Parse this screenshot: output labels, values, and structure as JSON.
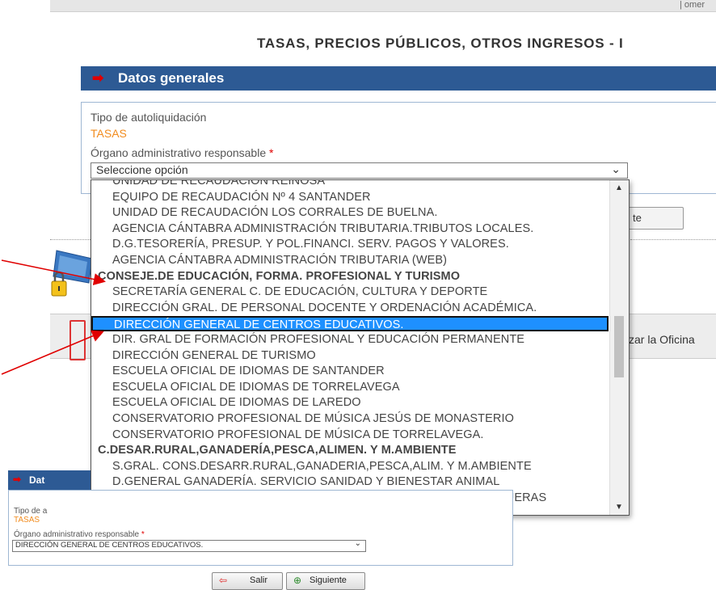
{
  "header": {
    "topstrip_text": "| omer",
    "title": "TASAS, PRECIOS PÚBLICOS, OTROS INGRESOS - I"
  },
  "main_panel": {
    "heading": "Datos generales",
    "tipo_label": "Tipo de autoliquidación",
    "tipo_value": "TASAS",
    "organo_label": "Órgano administrativo responsable",
    "required_mark": "*",
    "select_value": "Seleccione opción"
  },
  "background": {
    "button_text": "te",
    "lock_letters": "te",
    "band_text": "zar la Oficina"
  },
  "dropdown": {
    "items": [
      {
        "label": "UNIDAD DE RECAUDACIÓN REINOSA",
        "type": "option"
      },
      {
        "label": "EQUIPO DE RECAUDACIÓN Nº 4 SANTANDER",
        "type": "option"
      },
      {
        "label": "UNIDAD DE RECAUDACIÓN LOS CORRALES DE BUELNA.",
        "type": "option"
      },
      {
        "label": "AGENCIA CÁNTABRA ADMINISTRACIÓN TRIBUTARIA.TRIBUTOS LOCALES.",
        "type": "option"
      },
      {
        "label": "D.G.TESORERÍA, PRESUP. Y POL.FINANCI. SERV. PAGOS Y VALORES.",
        "type": "option"
      },
      {
        "label": "AGENCIA CÁNTABRA ADMINISTRACIÓN TRIBUTARIA (WEB)",
        "type": "option"
      },
      {
        "label": "CONSEJE.DE EDUCACIÓN, FORMA. PROFESIONAL Y TURISMO",
        "type": "group"
      },
      {
        "label": "SECRETARÍA GENERAL C. DE EDUCACIÓN, CULTURA Y DEPORTE",
        "type": "option"
      },
      {
        "label": "DIRECCIÓN GRAL. DE PERSONAL DOCENTE Y ORDENACIÓN ACADÉMICA.",
        "type": "option"
      },
      {
        "label": "DIRECCIÓN GENERAL DE CENTROS EDUCATIVOS.",
        "type": "selected"
      },
      {
        "label": "DIR. GRAL DE FORMACIÓN PROFESIONAL Y EDUCACIÓN PERMANENTE",
        "type": "option"
      },
      {
        "label": "DIRECCIÓN GENERAL DE TURISMO",
        "type": "option"
      },
      {
        "label": "ESCUELA OFICIAL DE IDIOMAS DE SANTANDER",
        "type": "option"
      },
      {
        "label": "ESCUELA OFICIAL DE IDIOMAS DE TORRELAVEGA",
        "type": "option"
      },
      {
        "label": "ESCUELA OFICIAL DE IDIOMAS DE LAREDO",
        "type": "option"
      },
      {
        "label": "CONSERVATORIO PROFESIONAL DE MÚSICA JESÚS DE MONASTERIO",
        "type": "option"
      },
      {
        "label": "CONSERVATORIO PROFESIONAL DE MÚSICA DE TORRELAVEGA.",
        "type": "option"
      },
      {
        "label": "C.DESAR.RURAL,GANADERÍA,PESCA,ALIMEN. Y M.AMBIENTE",
        "type": "group"
      },
      {
        "label": "S.GRAL. CONS.DESARR.RURAL,GANADERIA,PESCA,ALIM. Y M.AMBIENTE",
        "type": "option"
      },
      {
        "label": "D.GENERAL GANADERÍA. SERVICIO SANIDAD Y BIENESTAR ANIMAL",
        "type": "option"
      },
      {
        "label": "D.GENERAL PESCA Y ALIMENTACIÓN. SERVICIO ACTIVIDADES PESQUERAS",
        "type": "option"
      }
    ]
  },
  "mini_panel": {
    "heading": "Dat",
    "tipo_label": "Tipo de a",
    "tipo_value": "TASAS",
    "organo_label": "Órgano administrativo responsable",
    "required_mark": "*",
    "select_value": "DIRECCIÓN GENERAL DE CENTROS EDUCATIVOS."
  },
  "buttons": {
    "salir": "Salir",
    "siguiente": "Siguiente"
  },
  "colors": {
    "header_blue": "#2d5a94",
    "arrow_red": "#e00000",
    "value_orange": "#f28c1e",
    "selection_blue": "#1e90ff"
  }
}
